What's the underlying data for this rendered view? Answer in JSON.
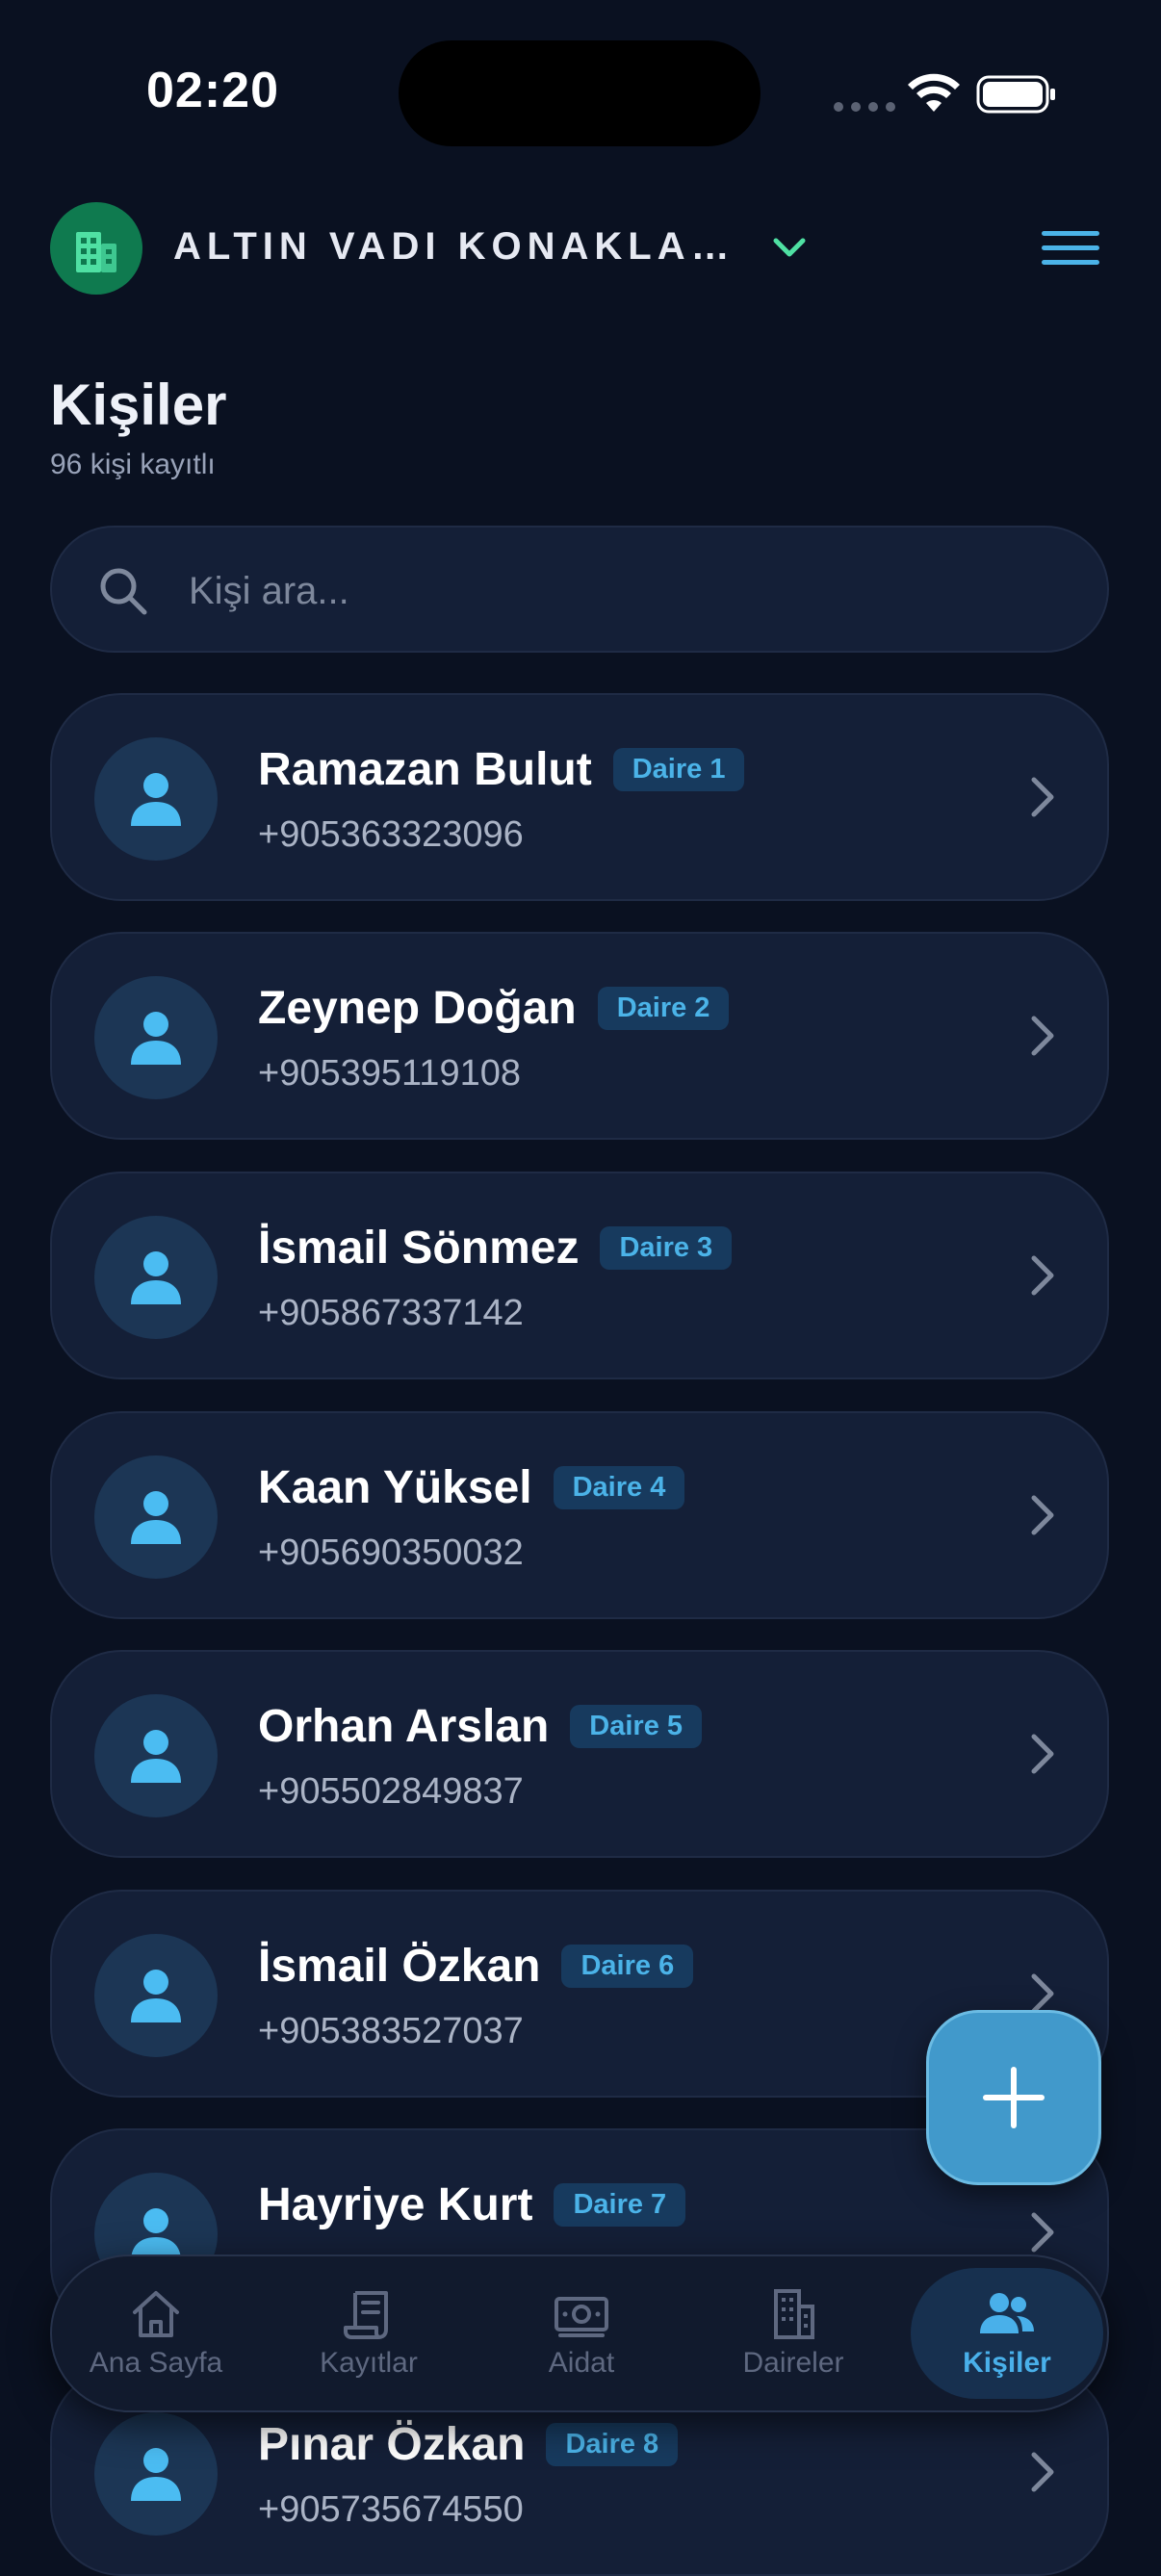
{
  "status_bar": {
    "time": "02:20"
  },
  "header": {
    "building_name": "ALTIN VADI KONAKLA…",
    "building_icon": "building-icon",
    "dropdown_icon": "chevron-down-icon",
    "menu_icon": "hamburger-menu-icon"
  },
  "page": {
    "title": "Kişiler",
    "subtitle": "96 kişi kayıtlı"
  },
  "search": {
    "placeholder": "Kişi ara..."
  },
  "contacts": [
    {
      "name": "Ramazan Bulut",
      "unit": "Daire 1",
      "phone": "+905363323096"
    },
    {
      "name": "Zeynep Doğan",
      "unit": "Daire 2",
      "phone": "+905395119108"
    },
    {
      "name": "İsmail Sönmez",
      "unit": "Daire 3",
      "phone": "+905867337142"
    },
    {
      "name": "Kaan Yüksel",
      "unit": "Daire 4",
      "phone": "+905690350032"
    },
    {
      "name": "Orhan Arslan",
      "unit": "Daire 5",
      "phone": "+905502849837"
    },
    {
      "name": "İsmail Özkan",
      "unit": "Daire 6",
      "phone": "+905383527037"
    },
    {
      "name": "Hayriye Kurt",
      "unit": "Daire 7",
      "phone": ""
    },
    {
      "name": "Pınar Özkan",
      "unit": "Daire 8",
      "phone": "+905735674550"
    }
  ],
  "fab": {
    "icon": "plus-icon"
  },
  "bottom_nav": {
    "items": [
      {
        "label": "Ana Sayfa",
        "icon": "home-icon",
        "active": false
      },
      {
        "label": "Kayıtlar",
        "icon": "receipt-icon",
        "active": false
      },
      {
        "label": "Aidat",
        "icon": "money-icon",
        "active": false
      },
      {
        "label": "Daireler",
        "icon": "building-icon",
        "active": false
      },
      {
        "label": "Kişiler",
        "icon": "people-icon",
        "active": true
      }
    ]
  },
  "colors": {
    "background": "#0a1121",
    "card": "#141f37",
    "accent": "#4bb3e8",
    "brand_green": "#0f7a4f",
    "fab": "#4199cb"
  }
}
